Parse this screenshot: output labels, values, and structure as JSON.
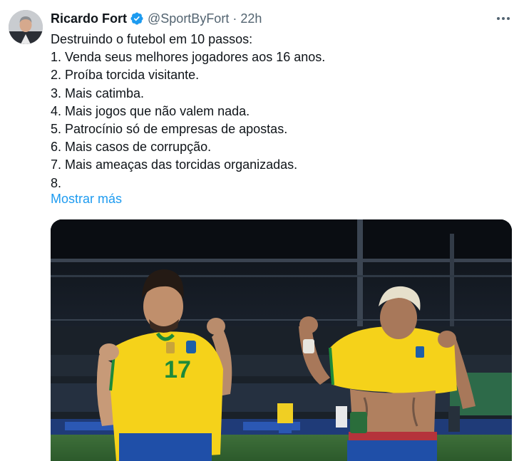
{
  "author": {
    "name": "Ricardo Fort",
    "handle": "@SportByFort",
    "separator": "·",
    "time": "22h"
  },
  "tweet": {
    "lines": [
      "Destruindo o futebol em 10 passos:",
      "1. Venda seus melhores jogadores aos 16 anos.",
      "2. Proíba torcida visitante.",
      "3. Mais catimba.",
      "4. Mais jogos que não valem nada.",
      "5. Patrocínio só de empresas de apostas.",
      "6. Mais casos de corrupção.",
      "7. Mais ameaças das torcidas organizadas.",
      "8."
    ],
    "show_more": "Mostrar más"
  },
  "media": {
    "left_player_number": "17"
  },
  "icons": {
    "verified": "verified-badge-icon",
    "more": "more-options-icon"
  },
  "colors": {
    "link_blue": "#1d9bf0",
    "secondary_text": "#536471",
    "jersey_yellow": "#f5d21a",
    "jersey_green": "#1d8a3a",
    "shorts_blue": "#1f4fa8"
  }
}
